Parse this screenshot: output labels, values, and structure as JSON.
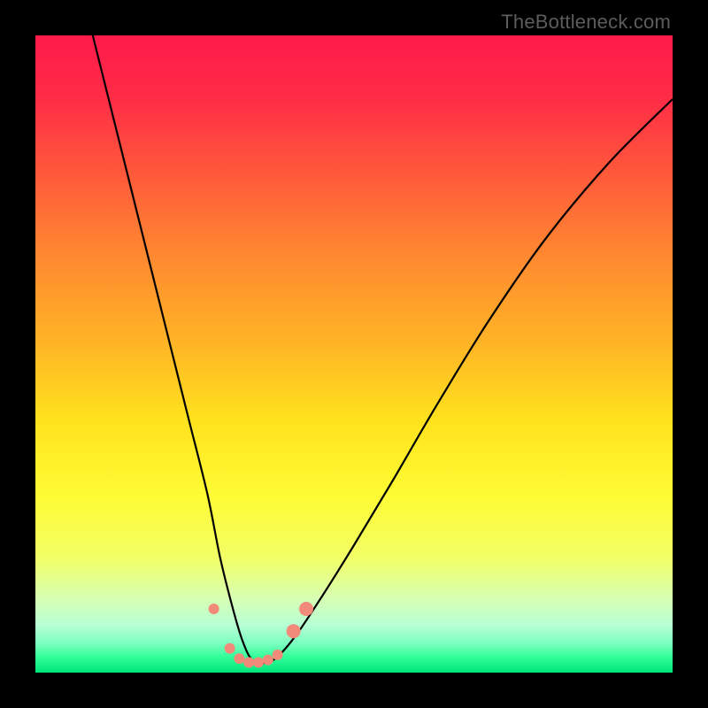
{
  "watermark": "TheBottleneck.com",
  "chart_data": {
    "type": "line",
    "title": "",
    "xlabel": "",
    "ylabel": "",
    "xlim": [
      0,
      100
    ],
    "ylim": [
      0,
      100
    ],
    "grid": false,
    "legend": false,
    "annotations": [],
    "gradient_stops": [
      {
        "offset": 0.0,
        "color": "#ff1a4b"
      },
      {
        "offset": 0.1,
        "color": "#ff2d46"
      },
      {
        "offset": 0.22,
        "color": "#ff5a3a"
      },
      {
        "offset": 0.35,
        "color": "#ff8a30"
      },
      {
        "offset": 0.48,
        "color": "#ffb326"
      },
      {
        "offset": 0.6,
        "color": "#ffe11d"
      },
      {
        "offset": 0.72,
        "color": "#fffb33"
      },
      {
        "offset": 0.82,
        "color": "#f2ff66"
      },
      {
        "offset": 0.88,
        "color": "#d9ffb0"
      },
      {
        "offset": 0.925,
        "color": "#b8ffd4"
      },
      {
        "offset": 0.955,
        "color": "#7affc0"
      },
      {
        "offset": 0.975,
        "color": "#33ff99"
      },
      {
        "offset": 1.0,
        "color": "#00e57a"
      }
    ],
    "series": [
      {
        "name": "bottleneck-curve",
        "x": [
          9,
          12,
          15,
          18,
          21,
          24,
          27,
          29,
          31,
          32.5,
          34,
          36,
          38,
          41,
          45,
          50,
          56,
          63,
          71,
          80,
          90,
          100
        ],
        "y": [
          100,
          88,
          76,
          64,
          52,
          40,
          28,
          18,
          10,
          5,
          2,
          1.5,
          2.5,
          6,
          12,
          20,
          30,
          42,
          55,
          68,
          80,
          90
        ]
      }
    ],
    "markers": {
      "name": "bottom-dots",
      "color": "#f28a7a",
      "radius_small": 6,
      "radius_large": 8,
      "points": [
        {
          "x": 28.0,
          "y": 10.0,
          "r": "small"
        },
        {
          "x": 30.5,
          "y": 3.8,
          "r": "small"
        },
        {
          "x": 32.0,
          "y": 2.2,
          "r": "small"
        },
        {
          "x": 33.5,
          "y": 1.6,
          "r": "small"
        },
        {
          "x": 35.0,
          "y": 1.6,
          "r": "small"
        },
        {
          "x": 36.5,
          "y": 2.0,
          "r": "small"
        },
        {
          "x": 38.0,
          "y": 2.8,
          "r": "small"
        },
        {
          "x": 40.5,
          "y": 6.5,
          "r": "large"
        },
        {
          "x": 42.5,
          "y": 10.0,
          "r": "large"
        }
      ]
    }
  }
}
